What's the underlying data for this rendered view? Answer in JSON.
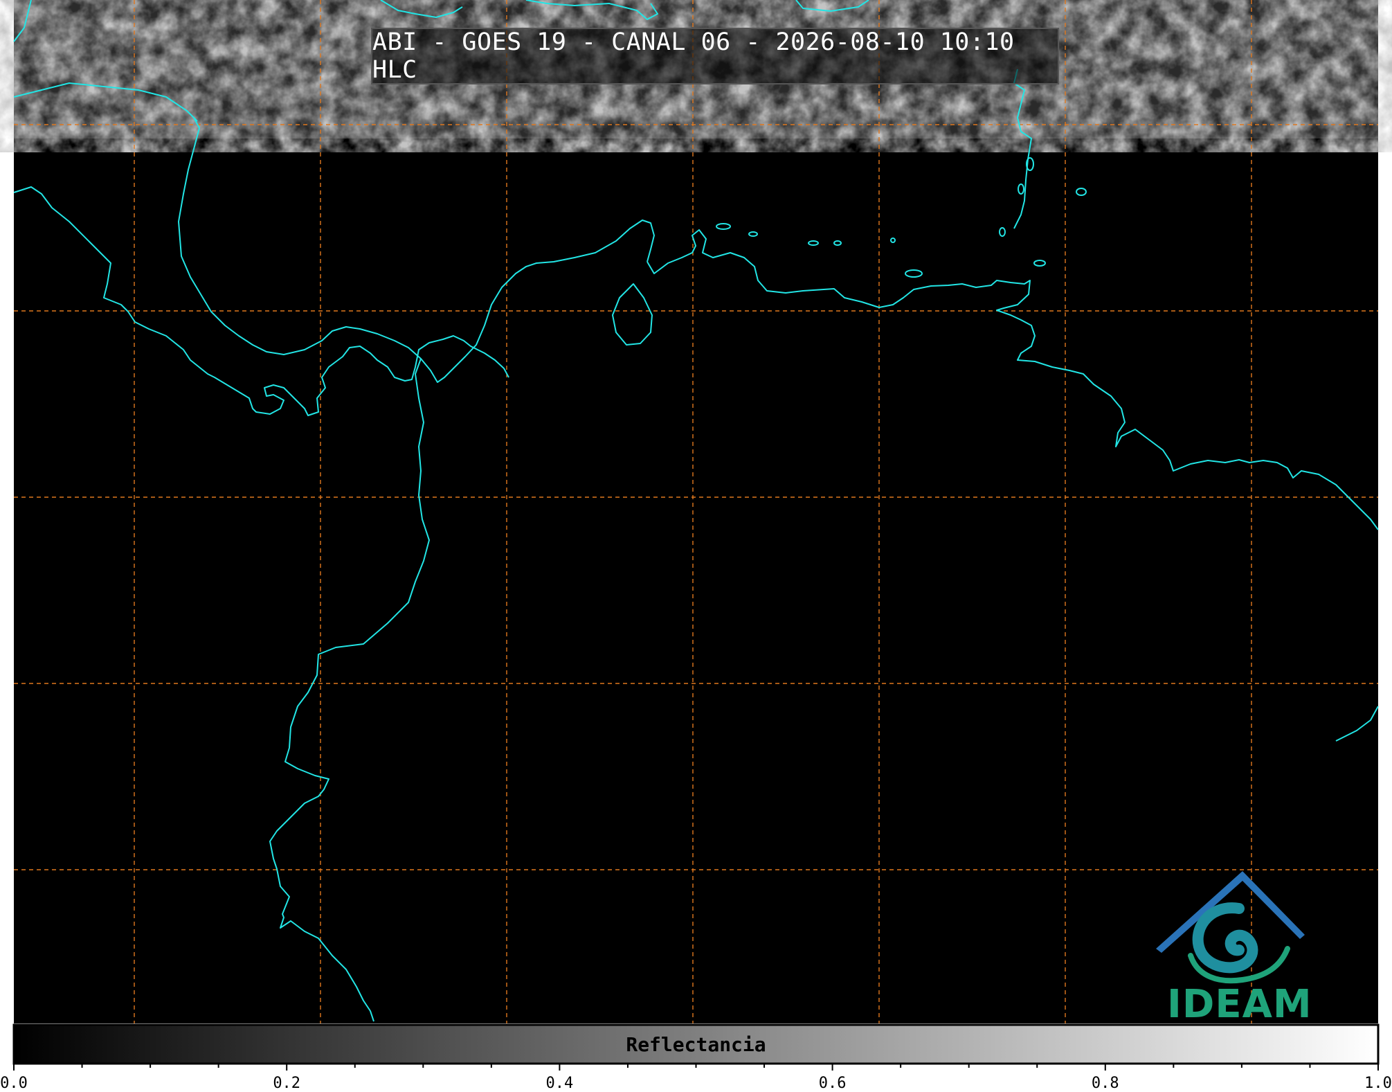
{
  "title": "ABI - GOES 19 - CANAL 06 - 2026-08-10 10:10 HLC",
  "logo": {
    "text": "IDEAM",
    "color": "#1fa37a"
  },
  "colorbar": {
    "label": "Reflectancia",
    "range": [
      0.0,
      1.0
    ],
    "ticks": [
      "0.0",
      "0.2",
      "0.4",
      "0.6",
      "0.8",
      "1.0"
    ],
    "colormap": "gray (black to white)"
  },
  "colors": {
    "coastline": "#22e5e5",
    "gridlines": "#e0781e",
    "background": "#000000"
  },
  "map": {
    "gridlines": "dashed",
    "coverage": "Caribbean / northwestern South America"
  }
}
